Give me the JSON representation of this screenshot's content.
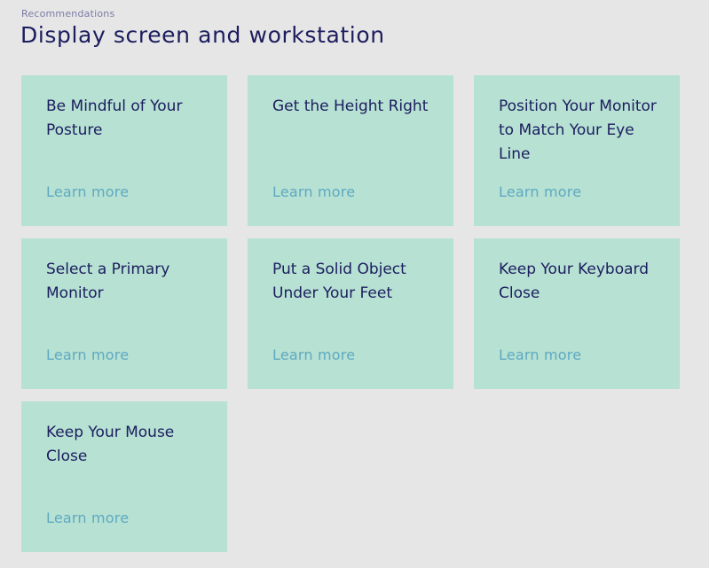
{
  "header": {
    "eyebrow": "Recommendations",
    "title": "Display screen and workstation"
  },
  "cards": [
    {
      "title": "Be Mindful of Your Posture",
      "link_label": "Learn more"
    },
    {
      "title": "Get the Height Right",
      "link_label": "Learn more"
    },
    {
      "title": "Position Your Monitor to Match Your Eye Line",
      "link_label": "Learn more"
    },
    {
      "title": "Select a Primary Monitor",
      "link_label": "Learn more"
    },
    {
      "title": "Put a Solid Object Under Your Feet",
      "link_label": "Learn more"
    },
    {
      "title": "Keep Your Keyboard Close",
      "link_label": "Learn more"
    },
    {
      "title": "Keep Your Mouse Close",
      "link_label": "Learn more"
    }
  ],
  "colors": {
    "background": "#e6e6e6",
    "card": "#b6e1d3",
    "title_text": "#1c1d5e",
    "link_text": "#5fa9c2"
  }
}
